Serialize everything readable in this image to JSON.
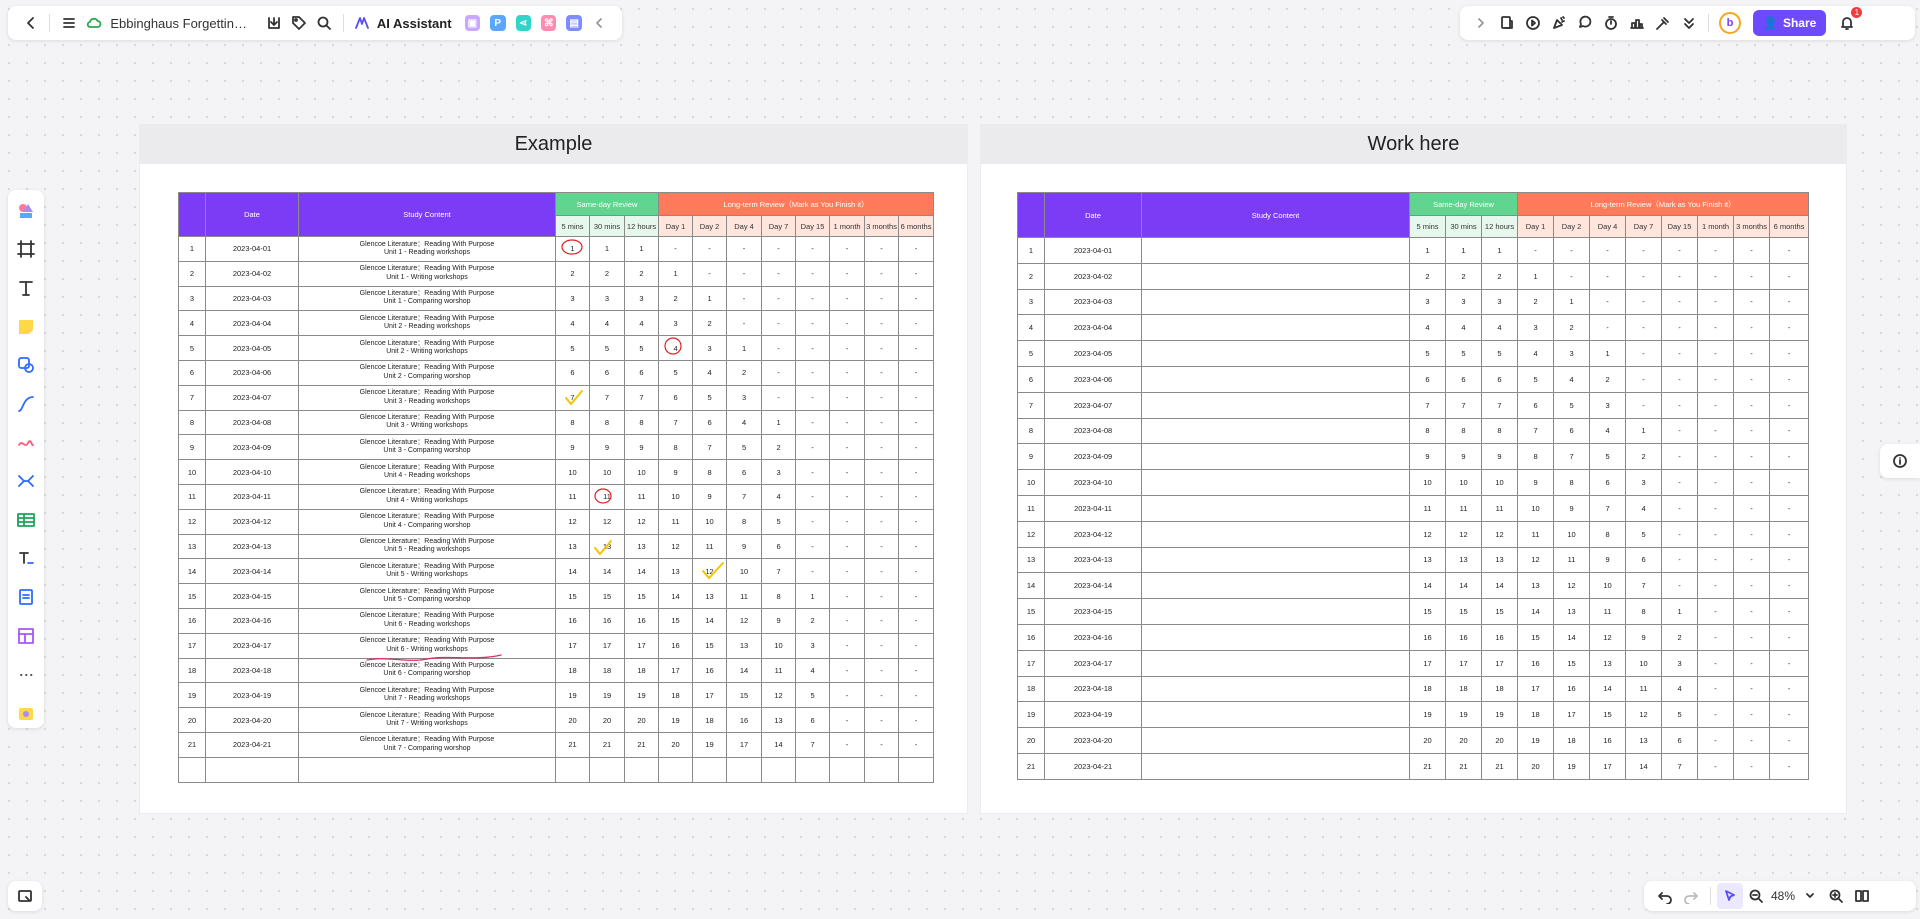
{
  "toolbar": {
    "doc_title": "Ebbinghaus Forgetting C...",
    "ai_label": "AI Assistant",
    "share_label": "Share",
    "notification_count": "1",
    "avatar_letter": "b",
    "zoom_level": "48%"
  },
  "colors": {
    "accent": "#6d4aff",
    "header_purple": "#7c3cf6",
    "header_green": "#5fd58f",
    "header_orange": "#ff7a5a",
    "annotation_red": "#e02020",
    "annotation_yellow": "#f5c400"
  },
  "icons": [
    "back-icon",
    "menu-icon",
    "cloud-icon",
    "download-icon",
    "tag-icon",
    "search-icon",
    "ai-logo-icon",
    "chevron-left-icon",
    "chevron-right-icon",
    "present-icon",
    "play-icon",
    "celebrate-icon",
    "comment-icon",
    "timer-icon",
    "vote-icon",
    "laser-icon",
    "expand-more-icon",
    "share-user-icon",
    "bell-icon",
    "undo-icon",
    "redo-icon",
    "select-icon",
    "zoom-out-icon",
    "chevron-down-icon",
    "zoom-in-icon",
    "map-icon",
    "info-icon"
  ],
  "board1": {
    "title": "Example"
  },
  "board2": {
    "title": "Work here"
  },
  "table": {
    "col_date": "Date",
    "col_study": "Study Content",
    "same_day": "Same-day Review",
    "long_term": "Long-term Review（Mark as You Finish it）",
    "same_day_cols": [
      "5 mins",
      "30 mins",
      "12 hours"
    ],
    "long_term_cols": [
      "Day 1",
      "Day 2",
      "Day 4",
      "Day 7",
      "Day 15",
      "1 month",
      "3 months",
      "6 months"
    ]
  },
  "rows": [
    {
      "n": "1",
      "date": "2023-04-01",
      "c1": "Glencoe Literature：Reading With Purpose",
      "c2": "Unit 1 - Reading workshops",
      "v": [
        "1",
        "1",
        "1",
        "-",
        "-",
        "-",
        "-",
        "-",
        "-",
        "-",
        "-"
      ]
    },
    {
      "n": "2",
      "date": "2023-04-02",
      "c1": "Glencoe Literature：Reading With Purpose",
      "c2": "Unit 1 - Writing workshops",
      "v": [
        "2",
        "2",
        "2",
        "1",
        "-",
        "-",
        "-",
        "-",
        "-",
        "-",
        "-"
      ]
    },
    {
      "n": "3",
      "date": "2023-04-03",
      "c1": "Glencoe Literature：Reading With Purpose",
      "c2": "Unit 1 - Comparing worshop",
      "v": [
        "3",
        "3",
        "3",
        "2",
        "1",
        "-",
        "-",
        "-",
        "-",
        "-",
        "-"
      ]
    },
    {
      "n": "4",
      "date": "2023-04-04",
      "c1": "Glencoe Literature：Reading With Purpose",
      "c2": "Unit 2 - Reading workshops",
      "v": [
        "4",
        "4",
        "4",
        "3",
        "2",
        "-",
        "-",
        "-",
        "-",
        "-",
        "-"
      ]
    },
    {
      "n": "5",
      "date": "2023-04-05",
      "c1": "Glencoe Literature：Reading With Purpose",
      "c2": "Unit 2 - Writing workshops",
      "v": [
        "5",
        "5",
        "5",
        "4",
        "3",
        "1",
        "-",
        "-",
        "-",
        "-",
        "-"
      ]
    },
    {
      "n": "6",
      "date": "2023-04-06",
      "c1": "Glencoe Literature：Reading With Purpose",
      "c2": "Unit 2 - Comparing worshop",
      "v": [
        "6",
        "6",
        "6",
        "5",
        "4",
        "2",
        "-",
        "-",
        "-",
        "-",
        "-"
      ]
    },
    {
      "n": "7",
      "date": "2023-04-07",
      "c1": "Glencoe Literature：Reading With Purpose",
      "c2": "Unit 3 - Reading workshops",
      "v": [
        "7",
        "7",
        "7",
        "6",
        "5",
        "3",
        "-",
        "-",
        "-",
        "-",
        "-"
      ]
    },
    {
      "n": "8",
      "date": "2023-04-08",
      "c1": "Glencoe Literature：Reading With Purpose",
      "c2": "Unit 3 - Writing workshops",
      "v": [
        "8",
        "8",
        "8",
        "7",
        "6",
        "4",
        "1",
        "-",
        "-",
        "-",
        "-"
      ]
    },
    {
      "n": "9",
      "date": "2023-04-09",
      "c1": "Glencoe Literature：Reading With Purpose",
      "c2": "Unit 3 - Comparing worshop",
      "v": [
        "9",
        "9",
        "9",
        "8",
        "7",
        "5",
        "2",
        "-",
        "-",
        "-",
        "-"
      ]
    },
    {
      "n": "10",
      "date": "2023-04-10",
      "c1": "Glencoe Literature：Reading With Purpose",
      "c2": "Unit 4 - Reading workshops",
      "v": [
        "10",
        "10",
        "10",
        "9",
        "8",
        "6",
        "3",
        "-",
        "-",
        "-",
        "-"
      ]
    },
    {
      "n": "11",
      "date": "2023-04-11",
      "c1": "Glencoe Literature：Reading With Purpose",
      "c2": "Unit 4 - Writing workshops",
      "v": [
        "11",
        "11",
        "11",
        "10",
        "9",
        "7",
        "4",
        "-",
        "-",
        "-",
        "-"
      ]
    },
    {
      "n": "12",
      "date": "2023-04-12",
      "c1": "Glencoe Literature：Reading With Purpose",
      "c2": "Unit 4 - Comparing worshop",
      "v": [
        "12",
        "12",
        "12",
        "11",
        "10",
        "8",
        "5",
        "-",
        "-",
        "-",
        "-"
      ]
    },
    {
      "n": "13",
      "date": "2023-04-13",
      "c1": "Glencoe Literature：Reading With Purpose",
      "c2": "Unit 5 - Reading workshops",
      "v": [
        "13",
        "13",
        "13",
        "12",
        "11",
        "9",
        "6",
        "-",
        "-",
        "-",
        "-"
      ]
    },
    {
      "n": "14",
      "date": "2023-04-14",
      "c1": "Glencoe Literature：Reading With Purpose",
      "c2": "Unit 5 - Writing workshops",
      "v": [
        "14",
        "14",
        "14",
        "13",
        "12",
        "10",
        "7",
        "-",
        "-",
        "-",
        "-"
      ]
    },
    {
      "n": "15",
      "date": "2023-04-15",
      "c1": "Glencoe Literature：Reading With Purpose",
      "c2": "Unit 5 - Comparing worshop",
      "v": [
        "15",
        "15",
        "15",
        "14",
        "13",
        "11",
        "8",
        "1",
        "-",
        "-",
        "-"
      ]
    },
    {
      "n": "16",
      "date": "2023-04-16",
      "c1": "Glencoe Literature：Reading With Purpose",
      "c2": "Unit 6 - Reading workshops",
      "v": [
        "16",
        "16",
        "16",
        "15",
        "14",
        "12",
        "9",
        "2",
        "-",
        "-",
        "-"
      ]
    },
    {
      "n": "17",
      "date": "2023-04-17",
      "c1": "Glencoe Literature：Reading With Purpose",
      "c2": "Unit 6 - Writing workshops",
      "v": [
        "17",
        "17",
        "17",
        "16",
        "15",
        "13",
        "10",
        "3",
        "-",
        "-",
        "-"
      ]
    },
    {
      "n": "18",
      "date": "2023-04-18",
      "c1": "Glencoe Literature：Reading With Purpose",
      "c2": "Unit 6 - Comparing worshop",
      "v": [
        "18",
        "18",
        "18",
        "17",
        "16",
        "14",
        "11",
        "4",
        "-",
        "-",
        "-"
      ]
    },
    {
      "n": "19",
      "date": "2023-04-19",
      "c1": "Glencoe Literature：Reading With Purpose",
      "c2": "Unit 7 - Reading workshops",
      "v": [
        "19",
        "19",
        "19",
        "18",
        "17",
        "15",
        "12",
        "5",
        "-",
        "-",
        "-"
      ]
    },
    {
      "n": "20",
      "date": "2023-04-20",
      "c1": "Glencoe Literature：Reading With Purpose",
      "c2": "Unit 7 - Writing workshops",
      "v": [
        "20",
        "20",
        "20",
        "19",
        "18",
        "16",
        "13",
        "6",
        "-",
        "-",
        "-"
      ]
    },
    {
      "n": "21",
      "date": "2023-04-21",
      "c1": "Glencoe Literature：Reading With Purpose",
      "c2": "Unit 7 - Comparing worshop",
      "v": [
        "21",
        "21",
        "21",
        "20",
        "19",
        "17",
        "14",
        "7",
        "-",
        "-",
        "-"
      ]
    }
  ]
}
